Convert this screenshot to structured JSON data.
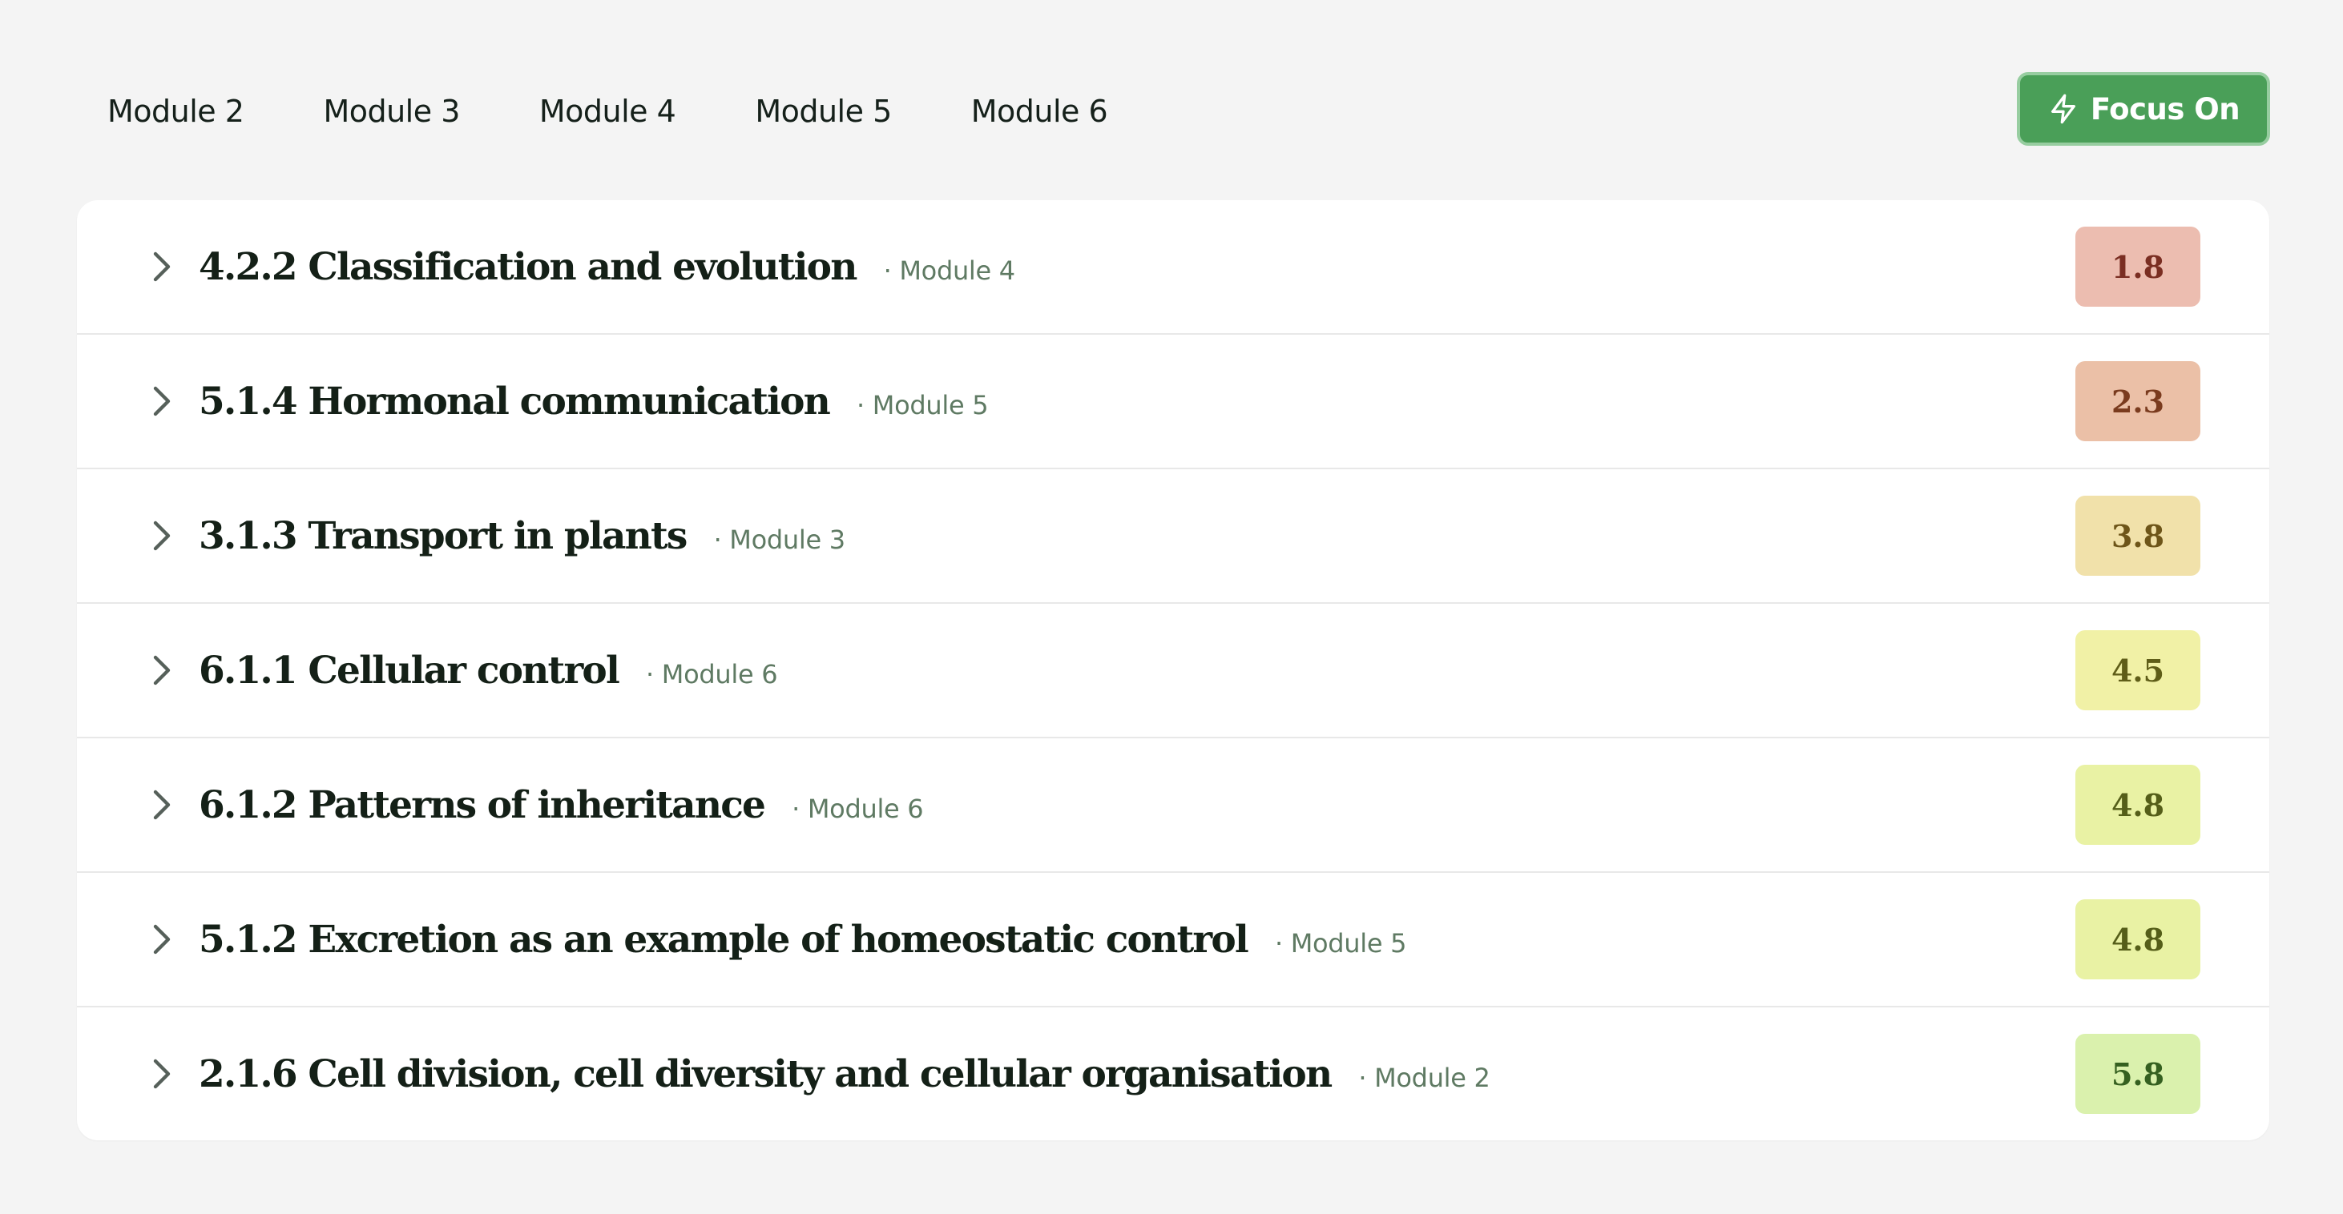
{
  "tabs": [
    {
      "label": "Module 2"
    },
    {
      "label": "Module 3"
    },
    {
      "label": "Module 4"
    },
    {
      "label": "Module 5"
    },
    {
      "label": "Module 6"
    }
  ],
  "focus_button": {
    "label": "Focus On",
    "icon": "lightning-bolt-icon"
  },
  "rows": [
    {
      "title": "4.2.2 Classification and evolution",
      "module": "· Module 4",
      "score": "1.8",
      "score_bg": "#ecbdb0",
      "score_color": "#7a2e22"
    },
    {
      "title": "5.1.4 Hormonal communication",
      "module": "· Module 5",
      "score": "2.3",
      "score_bg": "#ebc0a7",
      "score_color": "#7a3b1e"
    },
    {
      "title": "3.1.3 Transport in plants",
      "module": "· Module 3",
      "score": "3.8",
      "score_bg": "#f1e1aa",
      "score_color": "#6e5519"
    },
    {
      "title": "6.1.1 Cellular control",
      "module": "· Module 6",
      "score": "4.5",
      "score_bg": "#f1f1a6",
      "score_color": "#5f5d18"
    },
    {
      "title": "6.1.2 Patterns of inheritance",
      "module": "· Module 6",
      "score": "4.8",
      "score_bg": "#e9f2a4",
      "score_color": "#555e19"
    },
    {
      "title": "5.1.2 Excretion as an example of homeostatic control",
      "module": "· Module 5",
      "score": "4.8",
      "score_bg": "#e9f2a4",
      "score_color": "#555e19"
    },
    {
      "title": "2.1.6 Cell division, cell diversity and cellular organisation",
      "module": "· Module 2",
      "score": "5.8",
      "score_bg": "#daf1ad",
      "score_color": "#356020"
    }
  ]
}
